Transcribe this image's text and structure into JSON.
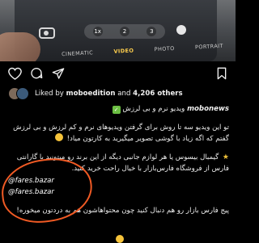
{
  "camera_photo": {
    "modes": [
      "CINEMATIC",
      "VIDEO",
      "PHOTO",
      "PORTRAIT"
    ],
    "active_mode": "VIDEO",
    "ratio_options": [
      "1x",
      "2",
      "3"
    ]
  },
  "post": {
    "likes": {
      "prefix": "Liked by",
      "user": "moboedition",
      "connector": "and",
      "count": "4,206 others"
    },
    "caption": {
      "username": "mobonews",
      "title_line": "ویدیو نرم و بی لرزش",
      "para1_line1": "تو این ویدیو سه تا روش برای گرفتن ویدیوهای نرم و کم لرزش و بی لرزش",
      "para1_line2": "گفتم که اگه زیاد با گوشی تصویر میگیرید به کارتون میاد!",
      "para2_line1": "گیمبال بیسوس یا هر لوازم جانبی دیگه از این برند رو میتونید با گارانتی",
      "para2_line2": "فارس از فروشگاه فارس‌بازار با خیال راحت خرید کنید.",
      "handle_1": "@fares.bazar",
      "handle_2": "@fares.bazar",
      "para3": "پیج فارس بازار رو هم دنبال کنید چون محتواهاشون هم به دردتون میخوره!"
    },
    "highlight_color": "#f05a24"
  }
}
